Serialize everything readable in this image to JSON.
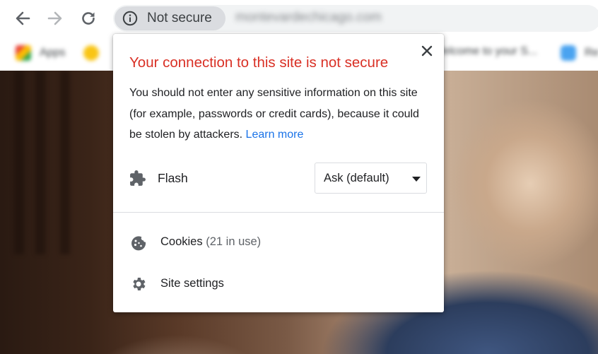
{
  "toolbar": {
    "security_chip_text": "Not secure",
    "url": "montevardechicago.com",
    "icons": [
      "back-arrow-icon",
      "forward-arrow-icon",
      "reload-icon",
      "info-icon"
    ]
  },
  "bookmarks": [
    {
      "label": "Apps",
      "icon": "apps-icon"
    },
    {
      "label": "",
      "icon": "bulb-icon"
    },
    {
      "label": "Welcome to your S...",
      "icon": "bookmark-icon"
    },
    {
      "label": "Re",
      "icon": "bookmark-icon"
    }
  ],
  "popup": {
    "title": "Your connection to this site is not secure",
    "description": "You should not enter any sensitive information on this site (for example, passwords or credit cards), because it could be stolen by attackers.",
    "learn_more": "Learn more",
    "permission": {
      "label": "Flash",
      "selected": "Ask (default)"
    },
    "cookies_label": "Cookies",
    "cookies_count": "(21 in use)",
    "site_settings_label": "Site settings"
  },
  "colors": {
    "warning_red": "#d93025",
    "link_blue": "#1a73e8",
    "chip_grey": "#dadce0",
    "omnibox_grey": "#f1f3f4",
    "icon_grey": "#5f6368"
  }
}
